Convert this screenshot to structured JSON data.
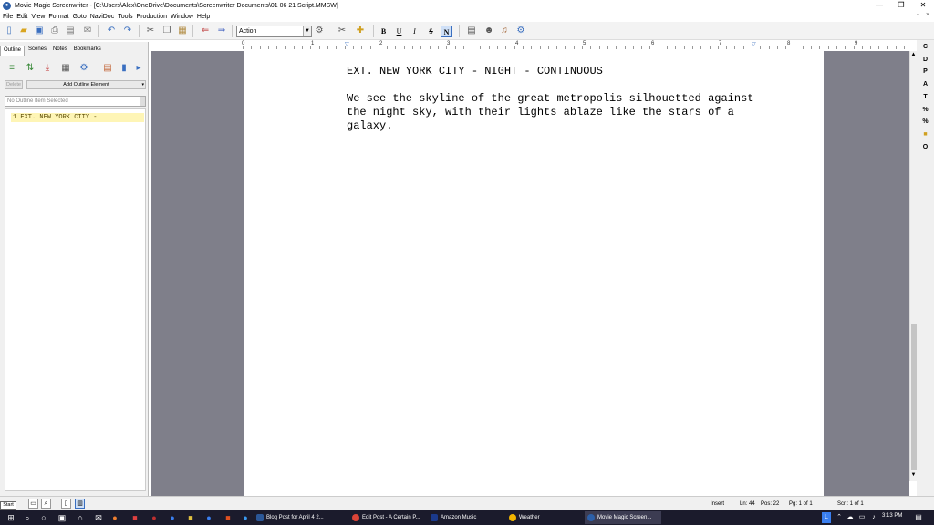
{
  "window": {
    "title": "Movie Magic Screenwriter - [C:\\Users\\Alex\\OneDrive\\Documents\\Screenwriter Documents\\01 06 21 Script.MMSW]",
    "minimize": "—",
    "restore": "❐",
    "close": "✕"
  },
  "menu": {
    "items": [
      "File",
      "Edit",
      "View",
      "Format",
      "Goto",
      "NaviDoc",
      "Tools",
      "Production",
      "Window",
      "Help"
    ],
    "mdi_controls": [
      "–",
      "▫",
      "×"
    ]
  },
  "toolbar": {
    "element_value": "Action",
    "bold": "B",
    "underline": "U",
    "italic": "I",
    "strike": "S",
    "normal": "N"
  },
  "left_panel": {
    "tabs": [
      "Outline",
      "Scenes",
      "Notes",
      "Bookmarks"
    ],
    "active_tab": "Outline",
    "delete_label": "Delete",
    "add_label": "Add Outline Element",
    "no_item_label": "No Outline Item Selected",
    "outline_items": [
      "1 EXT. NEW YORK CITY -"
    ]
  },
  "ruler": {
    "numbers": [
      "0",
      "1",
      "2",
      "3",
      "4",
      "5",
      "6",
      "7",
      "8",
      "9"
    ]
  },
  "script": {
    "scene_heading": "EXT. NEW YORK CITY - NIGHT - CONTINUOUS",
    "action_lines": [
      "We see the skyline of the great metropolis silhouetted against",
      "the night sky, with their lights ablaze like the stars of a",
      "galaxy."
    ]
  },
  "sidebar_buttons": [
    "C",
    "D",
    "P",
    "A",
    "T",
    "%",
    "%",
    "",
    "O"
  ],
  "status": {
    "mode": "Insert",
    "line": "Ln: 44",
    "pos": "Pos: 22",
    "page": "Pg: 1 of 1",
    "scene": "Scn: 1 of 1"
  },
  "taskbar": {
    "start_tooltip": "Start",
    "tasks": [
      {
        "label": "Blog Post for April 4 2...",
        "color": "#2b5797"
      },
      {
        "label": "Edit Post - A Certain P...",
        "color": "#db4437"
      },
      {
        "label": "Amazon Music",
        "color": "#1b3a8c"
      },
      {
        "label": "Weather",
        "color": "#f0b400"
      },
      {
        "label": "Movie Magic Screen...",
        "color": "#2c5fa8"
      }
    ],
    "time": "3:13 PM"
  },
  "colors": {
    "outline_highlight": "#fef5b6",
    "doc_background": "#7f7f8a",
    "taskbar": "#1b1b2c"
  }
}
